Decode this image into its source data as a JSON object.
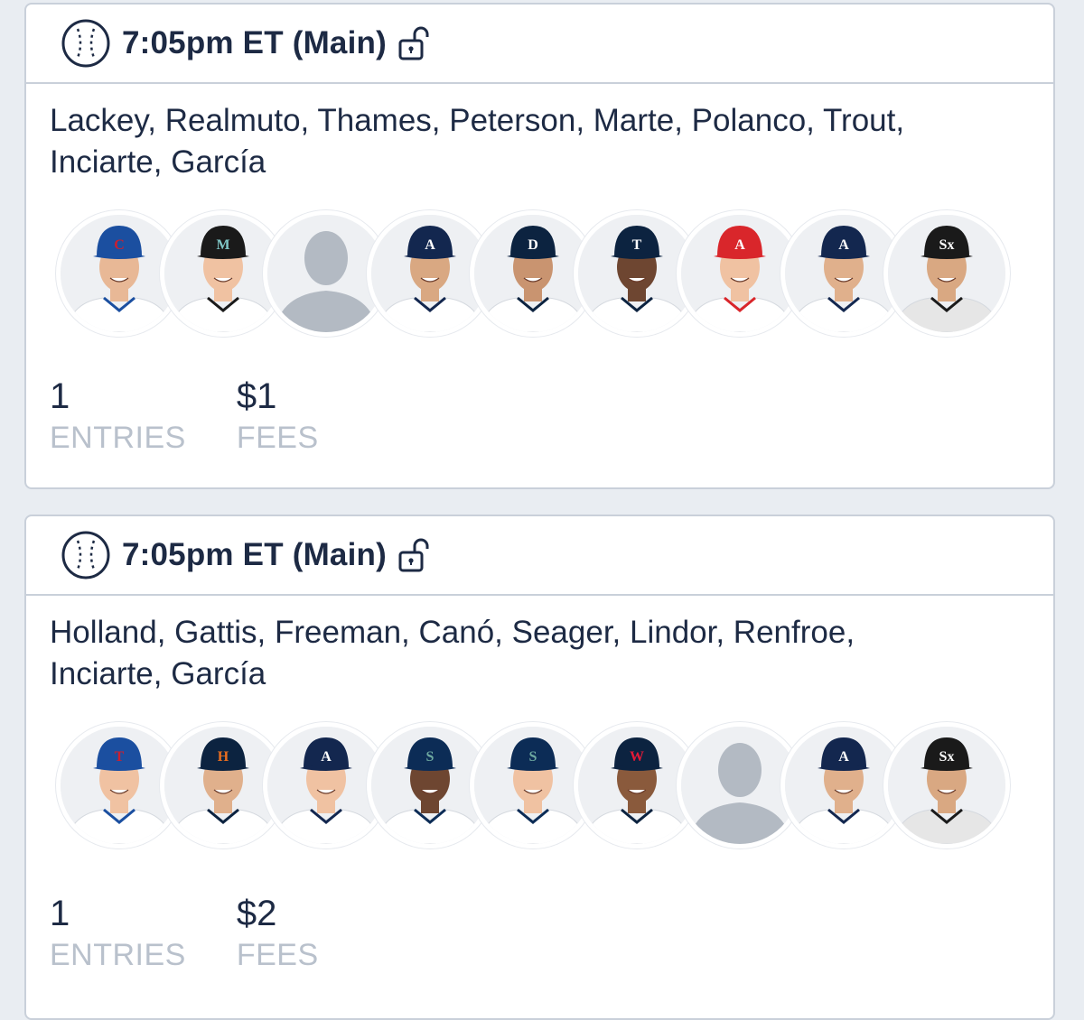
{
  "lineups": [
    {
      "title": "7:05pm ET (Main)",
      "players_line1": "Lackey, Realmuto, Thames, Peterson, Marte, Polanco, Trout,",
      "players_line2": "Inciarte, García",
      "avatars": [
        {
          "cap": "#1b4fa0",
          "logo": "C",
          "logo_color": "#cc1f2f",
          "jersey": "#ffffff",
          "skin": "#e8b896",
          "photo": true
        },
        {
          "cap": "#1a1a1a",
          "logo": "M",
          "logo_color": "#7fc6c6",
          "jersey": "#ffffff",
          "skin": "#f0c2a2",
          "photo": true
        },
        {
          "cap": "#b3bac3",
          "logo": "",
          "logo_color": "#b3bac3",
          "jersey": "#b3bac3",
          "skin": "#b3bac3",
          "photo": false
        },
        {
          "cap": "#13274f",
          "logo": "A",
          "logo_color": "#ffffff",
          "jersey": "#ffffff",
          "skin": "#d9a882",
          "photo": true
        },
        {
          "cap": "#0c2340",
          "logo": "D",
          "logo_color": "#ffffff",
          "jersey": "#ffffff",
          "skin": "#c99470",
          "photo": true
        },
        {
          "cap": "#0c2340",
          "logo": "T",
          "logo_color": "#ffffff",
          "jersey": "#ffffff",
          "skin": "#6e4631",
          "photo": true
        },
        {
          "cap": "#d9262b",
          "logo": "A",
          "logo_color": "#ffffff",
          "jersey": "#ffffff",
          "skin": "#f0c2a2",
          "photo": true
        },
        {
          "cap": "#13274f",
          "logo": "A",
          "logo_color": "#ffffff",
          "jersey": "#ffffff",
          "skin": "#e0b08c",
          "photo": true
        },
        {
          "cap": "#1a1a1a",
          "logo": "Sx",
          "logo_color": "#ffffff",
          "jersey": "#e6e6e6",
          "skin": "#d9a882",
          "photo": true
        }
      ],
      "entries_value": "1",
      "entries_label": "ENTRIES",
      "fees_value": "$1",
      "fees_label": "FEES"
    },
    {
      "title": "7:05pm ET (Main)",
      "players_line1": "Holland, Gattis, Freeman, Canó, Seager, Lindor, Renfroe,",
      "players_line2": "Inciarte, García",
      "avatars": [
        {
          "cap": "#1b4fa0",
          "logo": "T",
          "logo_color": "#cc1f2f",
          "jersey": "#ffffff",
          "skin": "#f0c2a2",
          "photo": true
        },
        {
          "cap": "#0c2340",
          "logo": "H",
          "logo_color": "#eb6e1f",
          "jersey": "#ffffff",
          "skin": "#e0b08c",
          "photo": true
        },
        {
          "cap": "#13274f",
          "logo": "A",
          "logo_color": "#ffffff",
          "jersey": "#ffffff",
          "skin": "#f0c2a2",
          "photo": true
        },
        {
          "cap": "#0c2c56",
          "logo": "S",
          "logo_color": "#6ea9a0",
          "jersey": "#ffffff",
          "skin": "#6e4631",
          "photo": true
        },
        {
          "cap": "#0c2c56",
          "logo": "S",
          "logo_color": "#6ea9a0",
          "jersey": "#ffffff",
          "skin": "#f0c2a2",
          "photo": true
        },
        {
          "cap": "#0c2340",
          "logo": "W",
          "logo_color": "#e31937",
          "jersey": "#ffffff",
          "skin": "#8a5a3c",
          "photo": true
        },
        {
          "cap": "#b3bac3",
          "logo": "",
          "logo_color": "#b3bac3",
          "jersey": "#b3bac3",
          "skin": "#b3bac3",
          "photo": false
        },
        {
          "cap": "#13274f",
          "logo": "A",
          "logo_color": "#ffffff",
          "jersey": "#ffffff",
          "skin": "#e0b08c",
          "photo": true
        },
        {
          "cap": "#1a1a1a",
          "logo": "Sx",
          "logo_color": "#ffffff",
          "jersey": "#e6e6e6",
          "skin": "#d9a882",
          "photo": true
        }
      ],
      "entries_value": "1",
      "entries_label": "ENTRIES",
      "fees_value": "$2",
      "fees_label": "FEES"
    }
  ],
  "icons": {
    "sport": "baseball-icon",
    "lock": "unlocked-padlock-icon"
  },
  "colors": {
    "text": "#1d2a44",
    "muted_label": "#b9c1cc",
    "divider": "#c9d0da",
    "background": "#e9edf2"
  }
}
